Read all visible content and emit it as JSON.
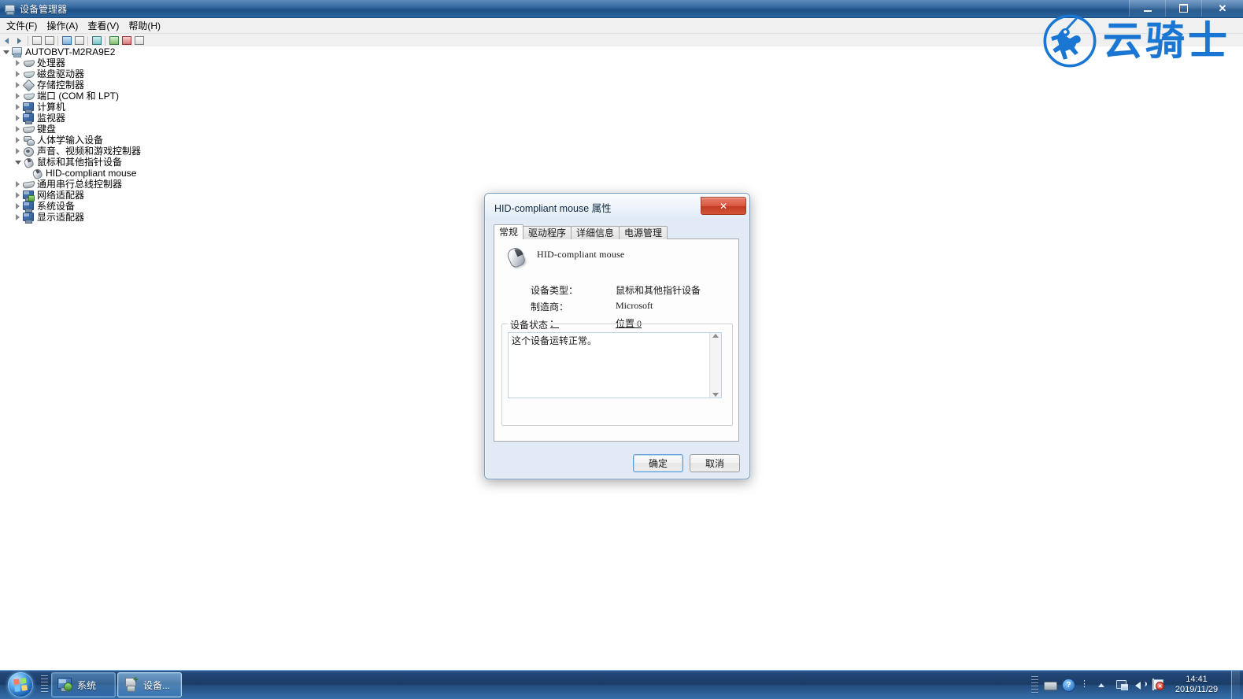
{
  "window": {
    "title": "设备管理器",
    "icon": "device-manager-icon",
    "controls": {
      "minimize": "−",
      "maximize": "❐",
      "close": "✕"
    }
  },
  "menubar": {
    "items": [
      {
        "label": "文件(F)",
        "name": "menu-file"
      },
      {
        "label": "操作(A)",
        "name": "menu-action"
      },
      {
        "label": "查看(V)",
        "name": "menu-view"
      },
      {
        "label": "帮助(H)",
        "name": "menu-help"
      }
    ]
  },
  "toolbar": {
    "buttons": [
      {
        "name": "toolbar-back-icon",
        "kind": "arrow-l"
      },
      {
        "name": "toolbar-forward-icon",
        "kind": "arrow-r"
      },
      {
        "name": "toolbar-separator",
        "kind": "sep"
      },
      {
        "name": "toolbar-show-hide-console-tree-icon",
        "kind": "sq"
      },
      {
        "name": "toolbar-properties-icon",
        "kind": "sq"
      },
      {
        "name": "toolbar-separator-2",
        "kind": "sep"
      },
      {
        "name": "toolbar-help-icon",
        "kind": "sq-blue"
      },
      {
        "name": "toolbar-scan-icon",
        "kind": "sq"
      },
      {
        "name": "toolbar-separator-3",
        "kind": "sep"
      },
      {
        "name": "toolbar-update-driver-icon",
        "kind": "sq-teal"
      },
      {
        "name": "toolbar-separator-4",
        "kind": "sep"
      },
      {
        "name": "toolbar-scan-hardware-changes-icon",
        "kind": "sq-green"
      },
      {
        "name": "toolbar-disable-device-icon",
        "kind": "sq-red"
      },
      {
        "name": "toolbar-uninstall-device-icon",
        "kind": "sq"
      }
    ]
  },
  "tree": {
    "root": {
      "label": "AUTOBVT-M2RA9E2",
      "icon": "computer-icon",
      "expanded": true
    },
    "items": [
      {
        "label": "处理器",
        "icon": "processor-icon",
        "indent": 1,
        "expandable": true,
        "expanded": false
      },
      {
        "label": "磁盘驱动器",
        "icon": "disk-drive-icon",
        "indent": 1,
        "expandable": true,
        "expanded": false
      },
      {
        "label": "存储控制器",
        "icon": "storage-controller-icon",
        "indent": 1,
        "expandable": true,
        "expanded": false
      },
      {
        "label": "端口 (COM 和 LPT)",
        "icon": "ports-icon",
        "indent": 1,
        "expandable": true,
        "expanded": false
      },
      {
        "label": "计算机",
        "icon": "computer-node-icon",
        "indent": 1,
        "expandable": true,
        "expanded": false
      },
      {
        "label": "监视器",
        "icon": "monitor-icon",
        "indent": 1,
        "expandable": true,
        "expanded": false
      },
      {
        "label": "键盘",
        "icon": "keyboard-icon",
        "indent": 1,
        "expandable": true,
        "expanded": false
      },
      {
        "label": "人体学输入设备",
        "icon": "hid-icon",
        "indent": 1,
        "expandable": true,
        "expanded": false
      },
      {
        "label": "声音、视频和游戏控制器",
        "icon": "sound-video-game-icon",
        "indent": 1,
        "expandable": true,
        "expanded": false
      },
      {
        "label": "鼠标和其他指针设备",
        "icon": "mouse-category-icon",
        "indent": 1,
        "expandable": true,
        "expanded": true
      },
      {
        "label": "HID-compliant mouse",
        "icon": "mouse-device-icon",
        "indent": 2,
        "expandable": false,
        "expanded": false,
        "selected": true
      },
      {
        "label": "通用串行总线控制器",
        "icon": "usb-controller-icon",
        "indent": 1,
        "expandable": true,
        "expanded": false
      },
      {
        "label": "网络适配器",
        "icon": "network-adapter-icon",
        "indent": 1,
        "expandable": true,
        "expanded": false
      },
      {
        "label": "系统设备",
        "icon": "system-device-icon",
        "indent": 1,
        "expandable": true,
        "expanded": false
      },
      {
        "label": "显示适配器",
        "icon": "display-adapter-icon",
        "indent": 1,
        "expandable": true,
        "expanded": false
      }
    ]
  },
  "dialog": {
    "title": "HID-compliant mouse 属性",
    "close_label": "✕",
    "tabs": [
      {
        "label": "常规",
        "active": true,
        "name": "tab-general"
      },
      {
        "label": "驱动程序",
        "active": false,
        "name": "tab-driver"
      },
      {
        "label": "详细信息",
        "active": false,
        "name": "tab-details"
      },
      {
        "label": "电源管理",
        "active": false,
        "name": "tab-power-management"
      }
    ],
    "device_name": "HID-compliant mouse",
    "properties": [
      {
        "key": "设备类型：",
        "value": "鼠标和其他指针设备"
      },
      {
        "key": "制造商：",
        "value": "Microsoft"
      },
      {
        "key": "位置：",
        "value": "位置 0"
      }
    ],
    "status_group_title": "设备状态",
    "status_text": "这个设备运转正常。",
    "buttons": {
      "ok": "确定",
      "cancel": "取消"
    }
  },
  "brand": {
    "text": "云骑士",
    "color": "#1976d2",
    "mark": "knight-horseman-emblem-icon"
  },
  "taskbar": {
    "start": {
      "name": "start-orb",
      "label": ""
    },
    "buttons": [
      {
        "label": "系统",
        "icon": "system-window-icon",
        "active": false,
        "name": "taskbar-button-system"
      },
      {
        "label": "设备...",
        "icon": "device-manager-window-icon",
        "active": true,
        "name": "taskbar-button-device-manager"
      }
    ],
    "tray": {
      "icons": [
        {
          "name": "keyboard-tray-icon",
          "glyph": "keyboard"
        },
        {
          "name": "help-tray-icon",
          "glyph": "?"
        },
        {
          "name": "overflow-dots-icon",
          "glyph": "⋮"
        },
        {
          "name": "show-hidden-icons-icon",
          "glyph": "▲"
        },
        {
          "name": "network-tray-icon",
          "glyph": "network"
        },
        {
          "name": "volume-tray-icon",
          "glyph": "volume"
        },
        {
          "name": "action-center-tray-icon",
          "glyph": "flag"
        }
      ],
      "clock": {
        "time": "14:41",
        "date": "2019/11/29"
      }
    }
  }
}
